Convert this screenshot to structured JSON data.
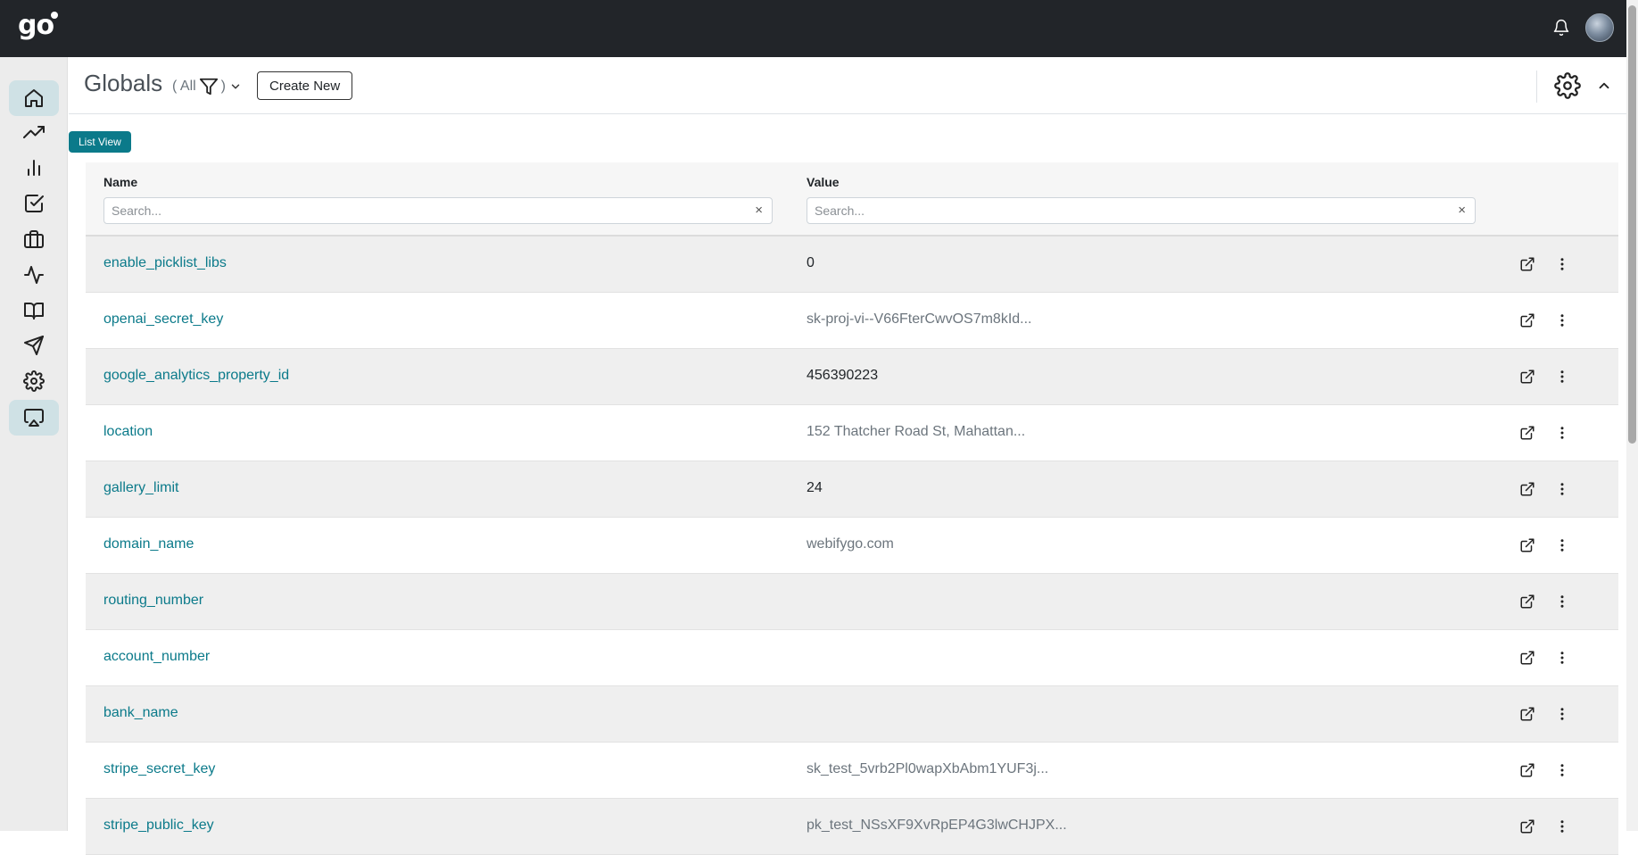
{
  "topbar": {
    "logo": "go"
  },
  "sidebar": {
    "items": [
      {
        "icon": "home-icon",
        "active": true
      },
      {
        "icon": "trending-up-icon",
        "active": false
      },
      {
        "icon": "bar-chart-icon",
        "active": false
      },
      {
        "icon": "check-square-icon",
        "active": false
      },
      {
        "icon": "briefcase-icon",
        "active": false
      },
      {
        "icon": "activity-icon",
        "active": false
      },
      {
        "icon": "book-open-icon",
        "active": false
      },
      {
        "icon": "send-icon",
        "active": false
      },
      {
        "icon": "settings-icon",
        "active": false
      },
      {
        "icon": "airplay-icon",
        "active": true
      }
    ]
  },
  "header": {
    "title": "Globals",
    "filter_open": "( All",
    "filter_close": ")",
    "create_label": "Create New"
  },
  "view": {
    "badge": "List View"
  },
  "table": {
    "columns": {
      "name": "Name",
      "value": "Value"
    },
    "search_placeholder": "Search...",
    "clear_glyph": "×",
    "rows": [
      {
        "name": "enable_picklist_libs",
        "value": "0",
        "value_style": "plain"
      },
      {
        "name": "openai_secret_key",
        "value": "sk-proj-vi--V66FterCwvOS7m8kId...",
        "value_style": "muted"
      },
      {
        "name": "google_analytics_property_id",
        "value": "456390223",
        "value_style": "plain"
      },
      {
        "name": "location",
        "value": "152 Thatcher Road St, Mahattan...",
        "value_style": "muted"
      },
      {
        "name": "gallery_limit",
        "value": "24",
        "value_style": "plain"
      },
      {
        "name": "domain_name",
        "value": "webifygo.com",
        "value_style": "muted"
      },
      {
        "name": "routing_number",
        "value": "",
        "value_style": "plain"
      },
      {
        "name": "account_number",
        "value": "",
        "value_style": "plain"
      },
      {
        "name": "bank_name",
        "value": "",
        "value_style": "plain"
      },
      {
        "name": "stripe_secret_key",
        "value": "sk_test_5vrb2Pl0wapXbAbm1YUF3j...",
        "value_style": "muted"
      },
      {
        "name": "stripe_public_key",
        "value": "pk_test_NSsXF9XvRpEP4G3lwCHJPX...",
        "value_style": "muted"
      }
    ]
  },
  "colors": {
    "accent": "#0b7a8a",
    "topbar": "#222529",
    "sidebar": "#ececec",
    "sidebar_active": "#cfe1e5",
    "value_plain": "#212529",
    "value_muted": "#6c757d"
  }
}
